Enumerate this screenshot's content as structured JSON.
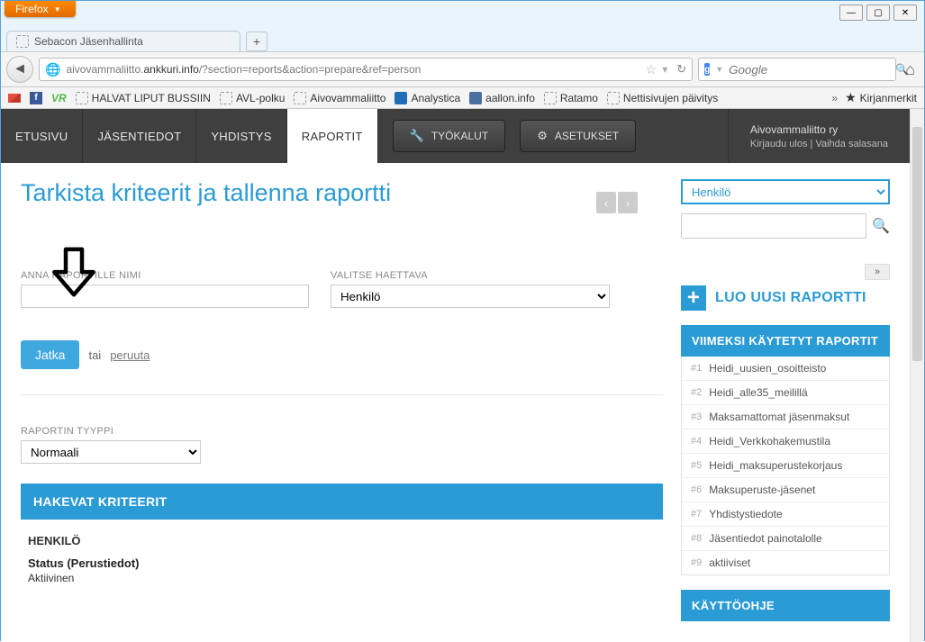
{
  "browser": {
    "name": "Firefox",
    "tab_title": "Sebacon Jäsenhallinta",
    "url_display_pre": "aivovammaliitto.",
    "url_display_dom": "ankkuri.info",
    "url_display_post": "/?section=reports&action=prepare&ref=person",
    "search_placeholder": "Google"
  },
  "bookmarks": {
    "items": [
      "HALVAT LIPUT BUSSIIN",
      "AVL-polku",
      "Aivovammaliitto",
      "Analystica",
      "aallon.info",
      "Ratamo",
      "Nettisivujen päivitys"
    ],
    "more_label": "Kirjanmerkit",
    "vr_label": "VR"
  },
  "nav": {
    "etusivu": "ETUSIVU",
    "jasentiedot": "JÄSENTIEDOT",
    "yhdistys": "YHDISTYS",
    "raportit": "RAPORTIT",
    "tyokalut": "TYÖKALUT",
    "asetukset": "ASETUKSET",
    "org": "Aivovammaliitto ry",
    "logout": "Kirjaudu ulos",
    "change_pw": "Vaihda salasana"
  },
  "page_title": "Tarkista kriteerit ja tallenna raportti",
  "side": {
    "entity": "Henkilö",
    "new_report": "LUO UUSI RAPORTTI",
    "recent_header": "VIIMEKSI KÄYTETYT RAPORTIT",
    "recent": [
      "Heidi_uusien_osoitteisto",
      "Heidi_alle35_meilillä",
      "Maksamattomat jäsenmaksut",
      "Heidi_Verkkohakemustila",
      "Heidi_maksuperustekorjaus",
      "Maksuperuste-jäsenet",
      "Yhdistystiedote",
      "Jäsentiedot painotalolle",
      "aktiiviset"
    ],
    "guide_header": "KÄYTTÖOHJE"
  },
  "form": {
    "name_label": "ANNA RAPORTILLE NIMI",
    "name_value": "",
    "target_label": "VALITSE HAETTAVA",
    "target_value": "Henkilö",
    "continue": "Jatka",
    "or": "tai",
    "cancel": "peruuta",
    "type_label": "RAPORTIN TYYPPI",
    "type_value": "Normaali",
    "criteria_header": "HAKEVAT KRITEERIT",
    "crit_section": "HENKILÖ",
    "crit_key": "Status (Perustiedot)",
    "crit_val": "Aktiivinen"
  }
}
